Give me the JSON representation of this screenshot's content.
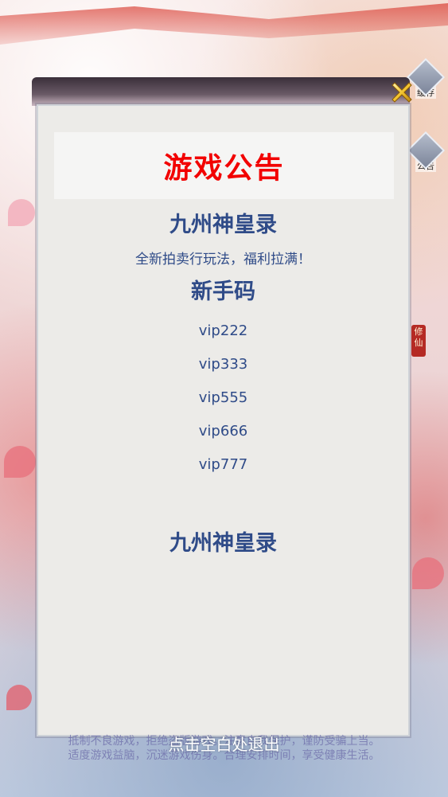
{
  "popup": {
    "title": "游戏公告",
    "game_name": "九州神皇录",
    "description": "全新拍卖行玩法，福利拉满！",
    "codes_heading": "新手码",
    "codes": [
      "vip222",
      "vip333",
      "vip555",
      "vip666",
      "vip777"
    ],
    "game_name_2": "九州神皇录"
  },
  "side_menu": {
    "button_1_label": "缓存",
    "button_2_label": "公告",
    "xiuxian_badge": "修仙"
  },
  "footer": {
    "exit_hint": "点击空白处退出",
    "notice_line_1": "抵制不良游戏，拒绝盗版游戏。注意自我保护，谨防受骗上当。",
    "notice_line_2": "适度游戏益脑，沉迷游戏伤身。合理安排时间，享受健康生活。"
  },
  "colors": {
    "title_red": "#f20000",
    "text_blue": "#2f4b88",
    "panel_bg": "#ecebe8"
  },
  "icons": {
    "close": "close-x-icon",
    "side_1": "cache-icon",
    "side_2": "announcement-icon"
  }
}
